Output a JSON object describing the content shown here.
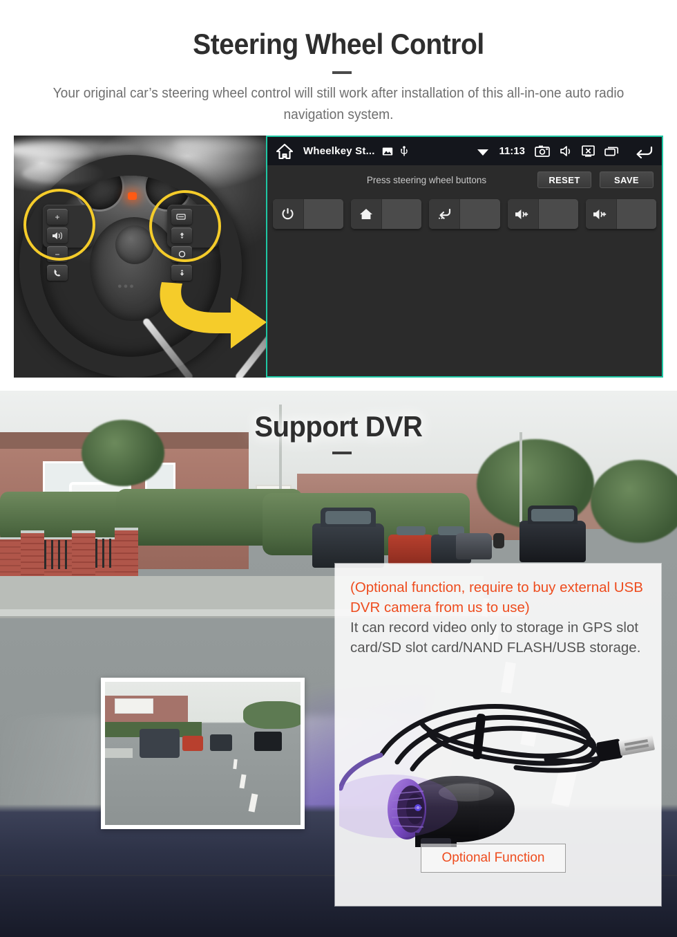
{
  "section_swc": {
    "title": "Steering Wheel Control",
    "subtitle": "Your original car’s steering wheel control will still work after installation of this all-in-one auto radio navigation system.",
    "photo_alt": "steering-wheel-photo",
    "head_unit": {
      "status_bar": {
        "home_icon": "home-icon",
        "app_title": "Wheelkey St...",
        "image_icon": "image-icon",
        "usb_icon": "usb-icon",
        "wifi_icon": "wifi-icon",
        "clock": "11:13",
        "screenshot_icon": "screenshot-camera-icon",
        "mute_icon": "mute-speaker-icon",
        "screen_off_icon": "screen-off-icon",
        "recents_icon": "recent-apps-icon",
        "back_icon": "back-arrow-icon"
      },
      "toolbar": {
        "hint": "Press steering wheel buttons",
        "reset_label": "RESET",
        "save_label": "SAVE"
      },
      "key_slots": [
        {
          "icon": "power-icon",
          "glyph": "⏻",
          "value": ""
        },
        {
          "icon": "home-icon",
          "glyph": "⌂",
          "value": ""
        },
        {
          "icon": "back-icon",
          "glyph": "↩",
          "value": ""
        },
        {
          "icon": "volume-up-icon",
          "glyph": "🔊+",
          "value": ""
        },
        {
          "icon": "volume-up-icon",
          "glyph": "🔊+",
          "value": ""
        }
      ]
    },
    "wheel_controls": {
      "left_pad": [
        "+",
        "voice-icon",
        "−",
        "call-icon"
      ],
      "right_pad": [
        "display-icon",
        "arrow-up-icon",
        "circle-icon",
        "arrow-down-icon"
      ],
      "highlight_color": "#f5cc2a",
      "arrow_color": "#f5cc2a"
    },
    "screen_border_color": "#1ec8a4"
  },
  "section_dvr": {
    "title": "Support DVR",
    "panel": {
      "orange_text": "(Optional function, require to buy external USB DVR camera from us to use)",
      "grey_text": "It can record video only to storage in GPS slot card/SD slot card/NAND FLASH/USB storage.",
      "orange_color": "#ee4c1e",
      "button_label": "Optional Function",
      "camera_image_alt": "usb-dvr-camera-with-cable"
    },
    "inset_alt": "dvr-recorded-dashcam-footage",
    "background_alt": "dashcam-street-view-through-windshield"
  }
}
